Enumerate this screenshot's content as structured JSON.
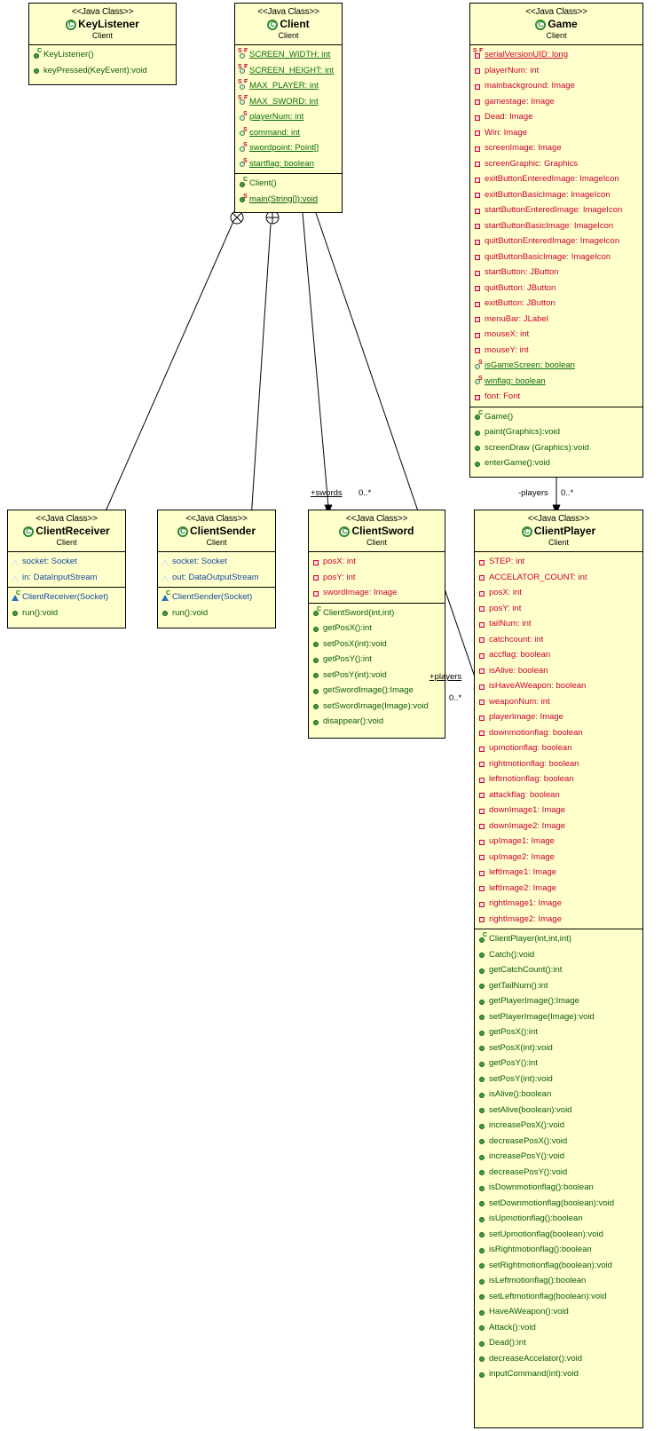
{
  "diagram": {
    "kind": "uml-class-diagram",
    "stereotype": "<<Java Class>>",
    "package": "Client",
    "background": "#ffffcc",
    "border": "#000000"
  },
  "classes": {
    "keylistener": {
      "stereotype": "<<Java Class>>",
      "name": "KeyListener",
      "package": "Client",
      "fields": [],
      "methods": [
        {
          "text": "KeyListener()",
          "vis": "public",
          "ctor": true,
          "static": false
        },
        {
          "text": "keyPressed(KeyEvent):void",
          "vis": "public",
          "ctor": false,
          "static": false
        }
      ]
    },
    "client": {
      "stereotype": "<<Java Class>>",
      "name": "Client",
      "package": "Client",
      "fields": [
        {
          "text": "SCREEN_WIDTH: int",
          "vis": "protected",
          "static": true,
          "final": true
        },
        {
          "text": "SCREEN_HEIGHT: int",
          "vis": "protected",
          "static": true,
          "final": true
        },
        {
          "text": "MAX_PLAYER: int",
          "vis": "protected",
          "static": true,
          "final": true
        },
        {
          "text": "MAX_SWORD: int",
          "vis": "protected",
          "static": true,
          "final": true
        },
        {
          "text": "playerNum: int",
          "vis": "protected",
          "static": true,
          "final": false
        },
        {
          "text": "command: int",
          "vis": "protected",
          "static": true,
          "final": false
        },
        {
          "text": "swordpoint: Point[]",
          "vis": "protected",
          "static": true,
          "final": false
        },
        {
          "text": "startflag: boolean",
          "vis": "protected",
          "static": true,
          "final": false
        }
      ],
      "methods": [
        {
          "text": "Client()",
          "vis": "public",
          "ctor": true,
          "static": false
        },
        {
          "text": "main(String[]):void",
          "vis": "public",
          "ctor": false,
          "static": true
        }
      ]
    },
    "game": {
      "stereotype": "<<Java Class>>",
      "name": "Game",
      "package": "Client",
      "fields": [
        {
          "text": "serialVersionUID: long",
          "vis": "private",
          "static": true,
          "final": true
        },
        {
          "text": "playerNum: int",
          "vis": "private",
          "static": false,
          "final": false
        },
        {
          "text": "mainbackground: Image",
          "vis": "private",
          "static": false,
          "final": false
        },
        {
          "text": "gamestage: Image",
          "vis": "private",
          "static": false,
          "final": false
        },
        {
          "text": "Dead: Image",
          "vis": "private",
          "static": false,
          "final": false
        },
        {
          "text": "Win: Image",
          "vis": "private",
          "static": false,
          "final": false
        },
        {
          "text": "screenImage: Image",
          "vis": "private",
          "static": false,
          "final": false
        },
        {
          "text": "screenGraphic: Graphics",
          "vis": "private",
          "static": false,
          "final": false
        },
        {
          "text": "exitButtonEnteredImage: ImageIcon",
          "vis": "private",
          "static": false,
          "final": false
        },
        {
          "text": "exitButtonBasicImage: ImageIcon",
          "vis": "private",
          "static": false,
          "final": false
        },
        {
          "text": "startButtonEnteredImage: ImageIcon",
          "vis": "private",
          "static": false,
          "final": false
        },
        {
          "text": "startButtonBasicImage: ImageIcon",
          "vis": "private",
          "static": false,
          "final": false
        },
        {
          "text": "quitButtonEnteredImage: ImageIcon",
          "vis": "private",
          "static": false,
          "final": false
        },
        {
          "text": "quitButtonBasicImage: ImageIcon",
          "vis": "private",
          "static": false,
          "final": false
        },
        {
          "text": "startButton: JButton",
          "vis": "private",
          "static": false,
          "final": false
        },
        {
          "text": "quitButton: JButton",
          "vis": "private",
          "static": false,
          "final": false
        },
        {
          "text": "exitButton: JButton",
          "vis": "private",
          "static": false,
          "final": false
        },
        {
          "text": "menuBar: JLabel",
          "vis": "private",
          "static": false,
          "final": false
        },
        {
          "text": "mouseX: int",
          "vis": "private",
          "static": false,
          "final": false
        },
        {
          "text": "mouseY: int",
          "vis": "private",
          "static": false,
          "final": false
        },
        {
          "text": "isGameScreen: boolean",
          "vis": "protected",
          "static": true,
          "final": false
        },
        {
          "text": "winflag: boolean",
          "vis": "protected",
          "static": true,
          "final": false
        },
        {
          "text": "font: Font",
          "vis": "private",
          "static": false,
          "final": false
        }
      ],
      "methods": [
        {
          "text": "Game()",
          "vis": "public",
          "ctor": true,
          "static": false
        },
        {
          "text": "paint(Graphics):void",
          "vis": "public",
          "ctor": false,
          "static": false
        },
        {
          "text": "screenDraw (Graphics):void",
          "vis": "public",
          "ctor": false,
          "static": false
        },
        {
          "text": "enterGame():void",
          "vis": "public",
          "ctor": false,
          "static": false
        }
      ]
    },
    "clientreceiver": {
      "stereotype": "<<Java Class>>",
      "name": "ClientReceiver",
      "package": "Client",
      "fields": [
        {
          "text": "socket: Socket",
          "vis": "package",
          "static": false,
          "final": false
        },
        {
          "text": "in: DataInputStream",
          "vis": "package",
          "static": false,
          "final": false
        }
      ],
      "methods": [
        {
          "text": "ClientReceiver(Socket)",
          "vis": "package",
          "ctor": true,
          "static": false
        },
        {
          "text": "run():void",
          "vis": "public",
          "ctor": false,
          "static": false
        }
      ]
    },
    "clientsender": {
      "stereotype": "<<Java Class>>",
      "name": "ClientSender",
      "package": "Client",
      "fields": [
        {
          "text": "socket: Socket",
          "vis": "package",
          "static": false,
          "final": false
        },
        {
          "text": "out: DataOutputStream",
          "vis": "package",
          "static": false,
          "final": false
        }
      ],
      "methods": [
        {
          "text": "ClientSender(Socket)",
          "vis": "package",
          "ctor": true,
          "static": false
        },
        {
          "text": "run():void",
          "vis": "public",
          "ctor": false,
          "static": false
        }
      ]
    },
    "clientsword": {
      "stereotype": "<<Java Class>>",
      "name": "ClientSword",
      "package": "Client",
      "fields": [
        {
          "text": "posX: int",
          "vis": "private",
          "static": false,
          "final": false
        },
        {
          "text": "posY: int",
          "vis": "private",
          "static": false,
          "final": false
        },
        {
          "text": "swordImage: Image",
          "vis": "private",
          "static": false,
          "final": false
        }
      ],
      "methods": [
        {
          "text": "ClientSword(int,int)",
          "vis": "public",
          "ctor": true,
          "static": false
        },
        {
          "text": "getPosX():int",
          "vis": "public",
          "ctor": false,
          "static": false
        },
        {
          "text": "setPosX(int):void",
          "vis": "public",
          "ctor": false,
          "static": false
        },
        {
          "text": "getPosY():int",
          "vis": "public",
          "ctor": false,
          "static": false
        },
        {
          "text": "setPosY(int):void",
          "vis": "public",
          "ctor": false,
          "static": false
        },
        {
          "text": "getSwordImage():Image",
          "vis": "public",
          "ctor": false,
          "static": false
        },
        {
          "text": "setSwordImage(Image):void",
          "vis": "public",
          "ctor": false,
          "static": false
        },
        {
          "text": "disappear():void",
          "vis": "public",
          "ctor": false,
          "static": false
        }
      ]
    },
    "clientplayer": {
      "stereotype": "<<Java Class>>",
      "name": "ClientPlayer",
      "package": "Client",
      "fields": [
        {
          "text": "STEP: int",
          "vis": "private",
          "static": false,
          "final": false
        },
        {
          "text": "ACCELATOR_COUNT: int",
          "vis": "private",
          "static": false,
          "final": false
        },
        {
          "text": "posX: int",
          "vis": "private",
          "static": false,
          "final": false
        },
        {
          "text": "posY: int",
          "vis": "private",
          "static": false,
          "final": false
        },
        {
          "text": "tailNum: int",
          "vis": "private",
          "static": false,
          "final": false
        },
        {
          "text": "catchcount: int",
          "vis": "private",
          "static": false,
          "final": false
        },
        {
          "text": "accflag: boolean",
          "vis": "private",
          "static": false,
          "final": false
        },
        {
          "text": "isAlive: boolean",
          "vis": "private",
          "static": false,
          "final": false
        },
        {
          "text": "isHaveAWeapon: boolean",
          "vis": "private",
          "static": false,
          "final": false
        },
        {
          "text": "weaponNum: int",
          "vis": "private",
          "static": false,
          "final": false
        },
        {
          "text": "playerImage: Image",
          "vis": "private",
          "static": false,
          "final": false
        },
        {
          "text": "downmotionflag: boolean",
          "vis": "private",
          "static": false,
          "final": false
        },
        {
          "text": "upmotionflag: boolean",
          "vis": "private",
          "static": false,
          "final": false
        },
        {
          "text": "rightmotionflag: boolean",
          "vis": "private",
          "static": false,
          "final": false
        },
        {
          "text": "leftmotionflag: boolean",
          "vis": "private",
          "static": false,
          "final": false
        },
        {
          "text": "attackflag: boolean",
          "vis": "private",
          "static": false,
          "final": false
        },
        {
          "text": "downImage1: Image",
          "vis": "private",
          "static": false,
          "final": false
        },
        {
          "text": "downImage2: Image",
          "vis": "private",
          "static": false,
          "final": false
        },
        {
          "text": "upImage1: Image",
          "vis": "private",
          "static": false,
          "final": false
        },
        {
          "text": "upImage2: Image",
          "vis": "private",
          "static": false,
          "final": false
        },
        {
          "text": "leftImage1: Image",
          "vis": "private",
          "static": false,
          "final": false
        },
        {
          "text": "leftImage2: Image",
          "vis": "private",
          "static": false,
          "final": false
        },
        {
          "text": "rightImage1: Image",
          "vis": "private",
          "static": false,
          "final": false
        },
        {
          "text": "rightImage2: Image",
          "vis": "private",
          "static": false,
          "final": false
        }
      ],
      "methods": [
        {
          "text": "ClientPlayer(int,int,int)",
          "vis": "public",
          "ctor": true,
          "static": false
        },
        {
          "text": "Catch():void",
          "vis": "public",
          "ctor": false,
          "static": false
        },
        {
          "text": "getCatchCount():int",
          "vis": "public",
          "ctor": false,
          "static": false
        },
        {
          "text": "getTailNum():int",
          "vis": "public",
          "ctor": false,
          "static": false
        },
        {
          "text": "getPlayerImage():Image",
          "vis": "public",
          "ctor": false,
          "static": false
        },
        {
          "text": "setPlayerImage(Image):void",
          "vis": "public",
          "ctor": false,
          "static": false
        },
        {
          "text": "getPosX():int",
          "vis": "public",
          "ctor": false,
          "static": false
        },
        {
          "text": "setPosX(int):void",
          "vis": "public",
          "ctor": false,
          "static": false
        },
        {
          "text": "getPosY():int",
          "vis": "public",
          "ctor": false,
          "static": false
        },
        {
          "text": "setPosY(int):void",
          "vis": "public",
          "ctor": false,
          "static": false
        },
        {
          "text": "isAlive():boolean",
          "vis": "public",
          "ctor": false,
          "static": false
        },
        {
          "text": "setAlive(boolean):void",
          "vis": "public",
          "ctor": false,
          "static": false
        },
        {
          "text": "increasePosX():void",
          "vis": "public",
          "ctor": false,
          "static": false
        },
        {
          "text": "decreasePosX():void",
          "vis": "public",
          "ctor": false,
          "static": false
        },
        {
          "text": "increasePosY():void",
          "vis": "public",
          "ctor": false,
          "static": false
        },
        {
          "text": "decreasePosY():void",
          "vis": "public",
          "ctor": false,
          "static": false
        },
        {
          "text": "isDownmotionflag():boolean",
          "vis": "public",
          "ctor": false,
          "static": false
        },
        {
          "text": "setDownmotionflag(boolean):void",
          "vis": "public",
          "ctor": false,
          "static": false
        },
        {
          "text": "isUpmotionflag():boolean",
          "vis": "public",
          "ctor": false,
          "static": false
        },
        {
          "text": "setUpmotionflag(boolean):void",
          "vis": "public",
          "ctor": false,
          "static": false
        },
        {
          "text": "isRightmotionflag():boolean",
          "vis": "public",
          "ctor": false,
          "static": false
        },
        {
          "text": "setRightmotionflag(boolean):void",
          "vis": "public",
          "ctor": false,
          "static": false
        },
        {
          "text": "isLeftmotionflag():boolean",
          "vis": "public",
          "ctor": false,
          "static": false
        },
        {
          "text": "setLeftmotionflag(boolean):void",
          "vis": "public",
          "ctor": false,
          "static": false
        },
        {
          "text": "HaveAWeapon():void",
          "vis": "public",
          "ctor": false,
          "static": false
        },
        {
          "text": "Attack():void",
          "vis": "public",
          "ctor": false,
          "static": false
        },
        {
          "text": "Dead():int",
          "vis": "public",
          "ctor": false,
          "static": false
        },
        {
          "text": "decreaseAccelator():void",
          "vis": "public",
          "ctor": false,
          "static": false
        },
        {
          "text": "inputCommand(int):void",
          "vis": "public",
          "ctor": false,
          "static": false
        }
      ]
    }
  },
  "associations": [
    {
      "id": "client-swords",
      "role": "+swords",
      "role_static": true,
      "multiplicity": "0..*"
    },
    {
      "id": "game-players",
      "role": "-players",
      "role_static": false,
      "multiplicity": "0..*"
    },
    {
      "id": "sword-players",
      "role": "+players",
      "role_static": true,
      "multiplicity": "0..*"
    }
  ]
}
